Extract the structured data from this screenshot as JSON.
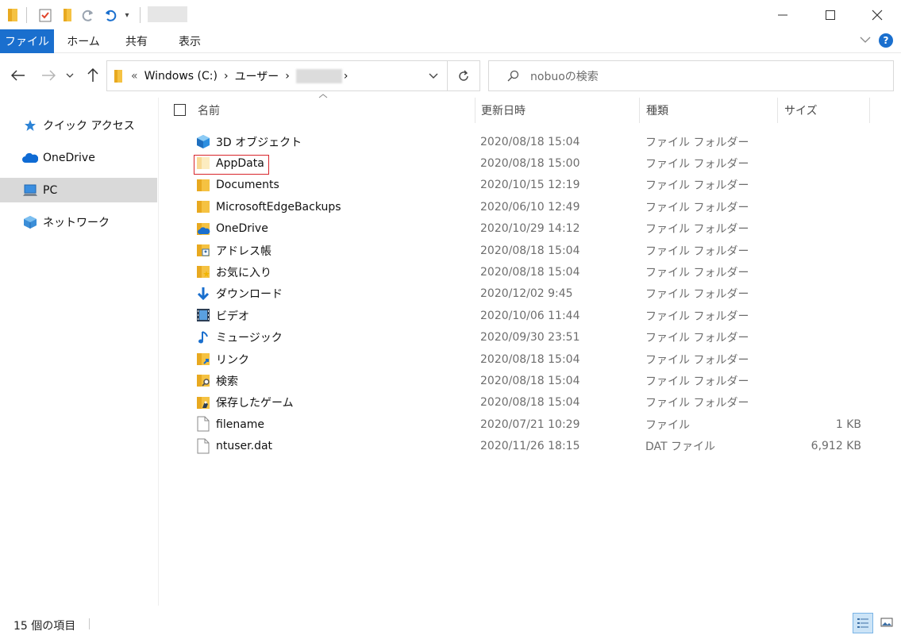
{
  "window": {
    "minimize_icon": "minimize-icon",
    "maximize_icon": "maximize-icon",
    "close_icon": "close-icon"
  },
  "ribbon": {
    "tabs": [
      "ファイル",
      "ホーム",
      "共有",
      "表示"
    ],
    "accent_color": "#1a6fce",
    "help_label": "?"
  },
  "address": {
    "overflow": "«",
    "crumbs": [
      "Windows (C:)",
      "ユーザー"
    ],
    "separator": "›"
  },
  "search": {
    "placeholder": "nobuoの検索"
  },
  "navpane": {
    "items": [
      {
        "label": "クイック アクセス",
        "icon": "star-icon"
      },
      {
        "label": "OneDrive",
        "icon": "cloud-icon"
      },
      {
        "label": "PC",
        "icon": "pc-icon",
        "selected": true
      },
      {
        "label": "ネットワーク",
        "icon": "network-icon"
      }
    ]
  },
  "columns": {
    "name": "名前",
    "date": "更新日時",
    "type": "種類",
    "size": "サイズ"
  },
  "files": [
    {
      "name": "3D オブジェクト",
      "date": "2020/08/18 15:04",
      "type": "ファイル フォルダー",
      "size": "",
      "icon": "3d-objects-folder-icon"
    },
    {
      "name": "AppData",
      "date": "2020/08/18 15:00",
      "type": "ファイル フォルダー",
      "size": "",
      "icon": "hidden-folder-icon",
      "highlighted": true
    },
    {
      "name": "Documents",
      "date": "2020/10/15 12:19",
      "type": "ファイル フォルダー",
      "size": "",
      "icon": "folder-icon"
    },
    {
      "name": "MicrosoftEdgeBackups",
      "date": "2020/06/10 12:49",
      "type": "ファイル フォルダー",
      "size": "",
      "icon": "folder-icon"
    },
    {
      "name": "OneDrive",
      "date": "2020/10/29 14:12",
      "type": "ファイル フォルダー",
      "size": "",
      "icon": "onedrive-folder-icon"
    },
    {
      "name": "アドレス帳",
      "date": "2020/08/18 15:04",
      "type": "ファイル フォルダー",
      "size": "",
      "icon": "contacts-folder-icon"
    },
    {
      "name": "お気に入り",
      "date": "2020/08/18 15:04",
      "type": "ファイル フォルダー",
      "size": "",
      "icon": "favorites-folder-icon"
    },
    {
      "name": "ダウンロード",
      "date": "2020/12/02 9:45",
      "type": "ファイル フォルダー",
      "size": "",
      "icon": "download-arrow-icon"
    },
    {
      "name": "ビデオ",
      "date": "2020/10/06 11:44",
      "type": "ファイル フォルダー",
      "size": "",
      "icon": "video-film-icon"
    },
    {
      "name": "ミュージック",
      "date": "2020/09/30 23:51",
      "type": "ファイル フォルダー",
      "size": "",
      "icon": "music-note-icon"
    },
    {
      "name": "リンク",
      "date": "2020/08/18 15:04",
      "type": "ファイル フォルダー",
      "size": "",
      "icon": "links-folder-icon"
    },
    {
      "name": "検索",
      "date": "2020/08/18 15:04",
      "type": "ファイル フォルダー",
      "size": "",
      "icon": "searches-folder-icon"
    },
    {
      "name": "保存したゲーム",
      "date": "2020/08/18 15:04",
      "type": "ファイル フォルダー",
      "size": "",
      "icon": "saved-games-folder-icon"
    },
    {
      "name": "filename",
      "date": "2020/07/21 10:29",
      "type": "ファイル",
      "size": "1 KB",
      "icon": "file-icon"
    },
    {
      "name": "ntuser.dat",
      "date": "2020/11/26 18:15",
      "type": "DAT ファイル",
      "size": "6,912 KB",
      "icon": "file-icon"
    }
  ],
  "status": {
    "count": "15 個の項目"
  }
}
